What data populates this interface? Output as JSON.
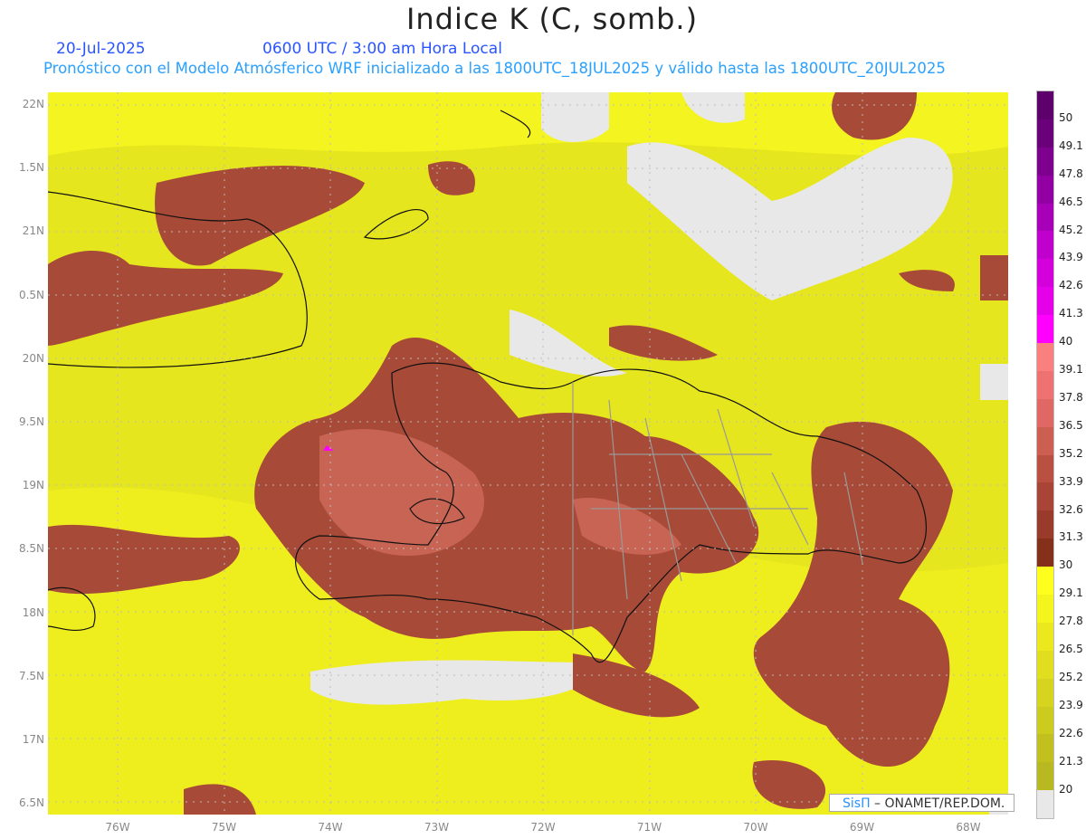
{
  "header": {
    "title": "Indice K (C, somb.)",
    "date": "20-Jul-2025",
    "time": "0600 UTC / 3:00 am Hora Local",
    "subtitle": "Pronóstico con el Modelo Atmósferico WRF inicializado a las 1800UTC_18JUL2025 y válido hasta las  1800UTC_20JUL2025"
  },
  "axes": {
    "lat_labels": [
      "22N",
      "1.5N",
      "21N",
      "0.5N",
      "20N",
      "9.5N",
      "19N",
      "8.5N",
      "18N",
      "7.5N",
      "17N",
      "6.5N"
    ],
    "lon_labels": [
      "76W",
      "75W",
      "74W",
      "73W",
      "72W",
      "71W",
      "70W",
      "69W",
      "68W"
    ]
  },
  "colorbar": {
    "labels": [
      "50",
      "49.1",
      "47.8",
      "46.5",
      "45.2",
      "43.9",
      "42.6",
      "41.3",
      "40",
      "39.1",
      "37.8",
      "36.5",
      "35.2",
      "33.9",
      "32.6",
      "31.3",
      "30",
      "29.1",
      "27.8",
      "26.5",
      "25.2",
      "23.9",
      "22.6",
      "21.3",
      "20"
    ],
    "colors": [
      "#5e006c",
      "#6a007a",
      "#7e008e",
      "#9200a4",
      "#a800b8",
      "#c000cc",
      "#d400dc",
      "#e400e8",
      "#ff00ff",
      "#fa8080",
      "#ee7272",
      "#e06864",
      "#cc5e52",
      "#ba5042",
      "#a84536",
      "#983b2a",
      "#84301a",
      "#ffff1e",
      "#f5f51e",
      "#ebe81e",
      "#e0de1e",
      "#d6d41e",
      "#cccc1e",
      "#c2c01e",
      "#b8b820",
      "#e8e8e8"
    ]
  },
  "credit": {
    "brand": "SisΠ",
    "text": " –  ONAMET/REP.DOM."
  }
}
